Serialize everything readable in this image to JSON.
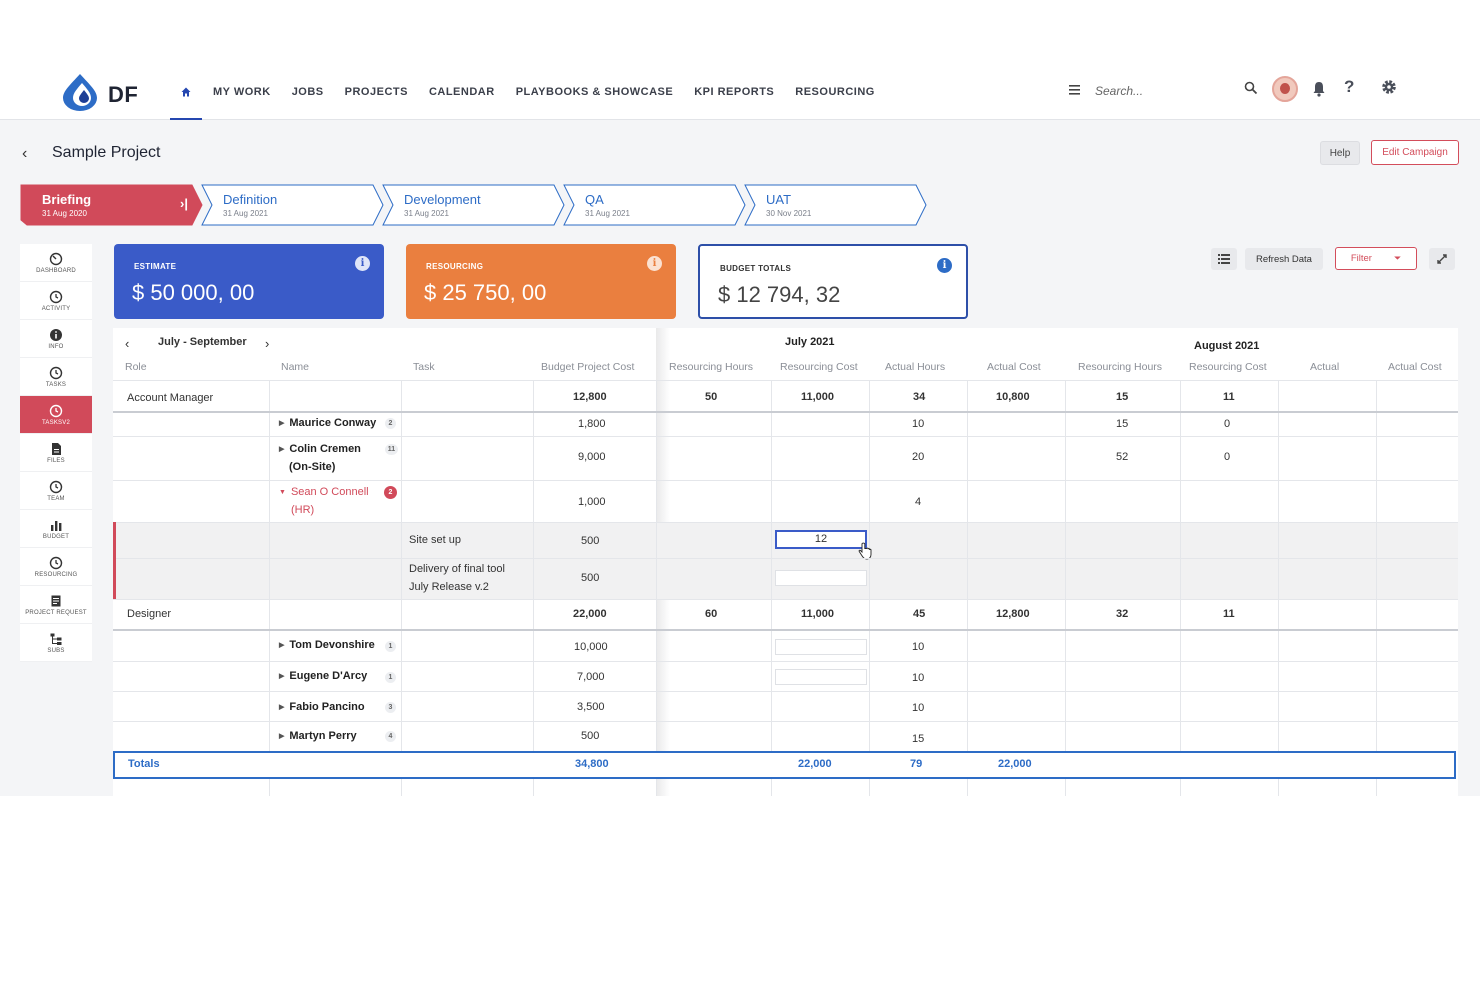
{
  "nav": {
    "logo_text": "DF",
    "items": [
      "MY WORK",
      "JOBS",
      "PROJECTS",
      "CALENDAR",
      "PLAYBOOKS & SHOWCASE",
      "KPI REPORTS",
      "RESOURCING"
    ],
    "search_placeholder": "Search...",
    "help_glyph": "?"
  },
  "page": {
    "title": "Sample Project",
    "back_glyph": "‹",
    "help_label": "Help",
    "edit_label": "Edit Campaign"
  },
  "stages": [
    {
      "name": "Briefing",
      "date": "31 Aug 2020",
      "active": true
    },
    {
      "name": "Definition",
      "date": "31 Aug 2021"
    },
    {
      "name": "Development",
      "date": "31 Aug 2021"
    },
    {
      "name": "QA",
      "date": "31 Aug 2021"
    },
    {
      "name": "UAT",
      "date": "30 Nov 2021"
    }
  ],
  "sidebar": [
    {
      "label": "DASHBOARD",
      "icon": "dashboard-icon"
    },
    {
      "label": "ACTIVITY",
      "icon": "clock-icon"
    },
    {
      "label": "INFO",
      "icon": "info-icon"
    },
    {
      "label": "TASKS",
      "icon": "clock-icon"
    },
    {
      "label": "TASKSV2",
      "icon": "clock-icon",
      "active": true
    },
    {
      "label": "FILES",
      "icon": "file-icon"
    },
    {
      "label": "TEAM",
      "icon": "clock-icon"
    },
    {
      "label": "BUDGET",
      "icon": "bar-chart-icon"
    },
    {
      "label": "RESOURCING",
      "icon": "clock-icon"
    },
    {
      "label": "PROJECT REQUEST",
      "icon": "document-icon"
    },
    {
      "label": "SUBS",
      "icon": "hierarchy-icon"
    }
  ],
  "cards": {
    "estimate": {
      "label": "ESTIMATE",
      "value": "$ 50 000, 00"
    },
    "resourcing": {
      "label": "RESOURCING",
      "value": "$ 25 750, 00"
    },
    "budget": {
      "label": "BUDGET TOTALS",
      "value": "$ 12 794, 32"
    },
    "info_glyph": "i"
  },
  "toolbar": {
    "refresh_label": "Refresh Data",
    "filter_label": "Filter"
  },
  "table": {
    "period": "July - September",
    "headers": {
      "role": "Role",
      "name": "Name",
      "task": "Task",
      "budget": "Budget Project Cost",
      "res_hours": "Resourcing Hours",
      "res_cost": "Resourcing Cost",
      "actual_hours": "Actual Hours",
      "actual_cost": "Actual Cost",
      "actual": "Actual"
    },
    "months": [
      "July 2021",
      "August 2021"
    ],
    "rows": {
      "account_manager": {
        "role": "Account Manager",
        "budget": "12,800",
        "jul_rh": "50",
        "jul_rc": "11,000",
        "jul_ah": "34",
        "jul_ac": "10,800",
        "aug_rh": "15",
        "aug_rc": "11"
      },
      "maurice": {
        "name": "Maurice Conway",
        "badge": "2",
        "budget": "1,800",
        "jul_ah": "10",
        "aug_rh": "15",
        "aug_rc": "0"
      },
      "colin": {
        "name": "Colin Cremen",
        "name2": "(On-Site)",
        "badge": "11",
        "budget": "9,000",
        "jul_ah": "20",
        "aug_rh": "52",
        "aug_rc": "0"
      },
      "sean": {
        "name": "Sean O Connell",
        "name2": "(HR)",
        "badge": "2",
        "budget": "1,000",
        "jul_ah": "4"
      },
      "task1": {
        "task": "Site set up",
        "budget": "500",
        "jul_rc": "12"
      },
      "task2": {
        "task": "Delivery of final tool",
        "task2": "July Release v.2",
        "budget": "500"
      },
      "designer": {
        "role": "Designer",
        "budget": "22,000",
        "jul_rh": "60",
        "jul_rc": "11,000",
        "jul_ah": "45",
        "jul_ac": "12,800",
        "aug_rh": "32",
        "aug_rc": "11"
      },
      "tom": {
        "name": "Tom Devonshire",
        "badge": "1",
        "budget": "10,000",
        "jul_ah": "10"
      },
      "eugene": {
        "name": "Eugene D'Arcy",
        "badge": "1",
        "budget": "7,000",
        "jul_ah": "10"
      },
      "fabio": {
        "name": "Fabio Pancino",
        "badge": "3",
        "budget": "3,500",
        "jul_ah": "10"
      },
      "martyn": {
        "name": "Martyn Perry",
        "badge": "4",
        "budget": "500",
        "jul_ah": "15"
      }
    },
    "totals": {
      "label": "Totals",
      "budget": "34,800",
      "jul_rc": "22,000",
      "jul_ah": "79",
      "jul_ac": "22,000"
    }
  }
}
